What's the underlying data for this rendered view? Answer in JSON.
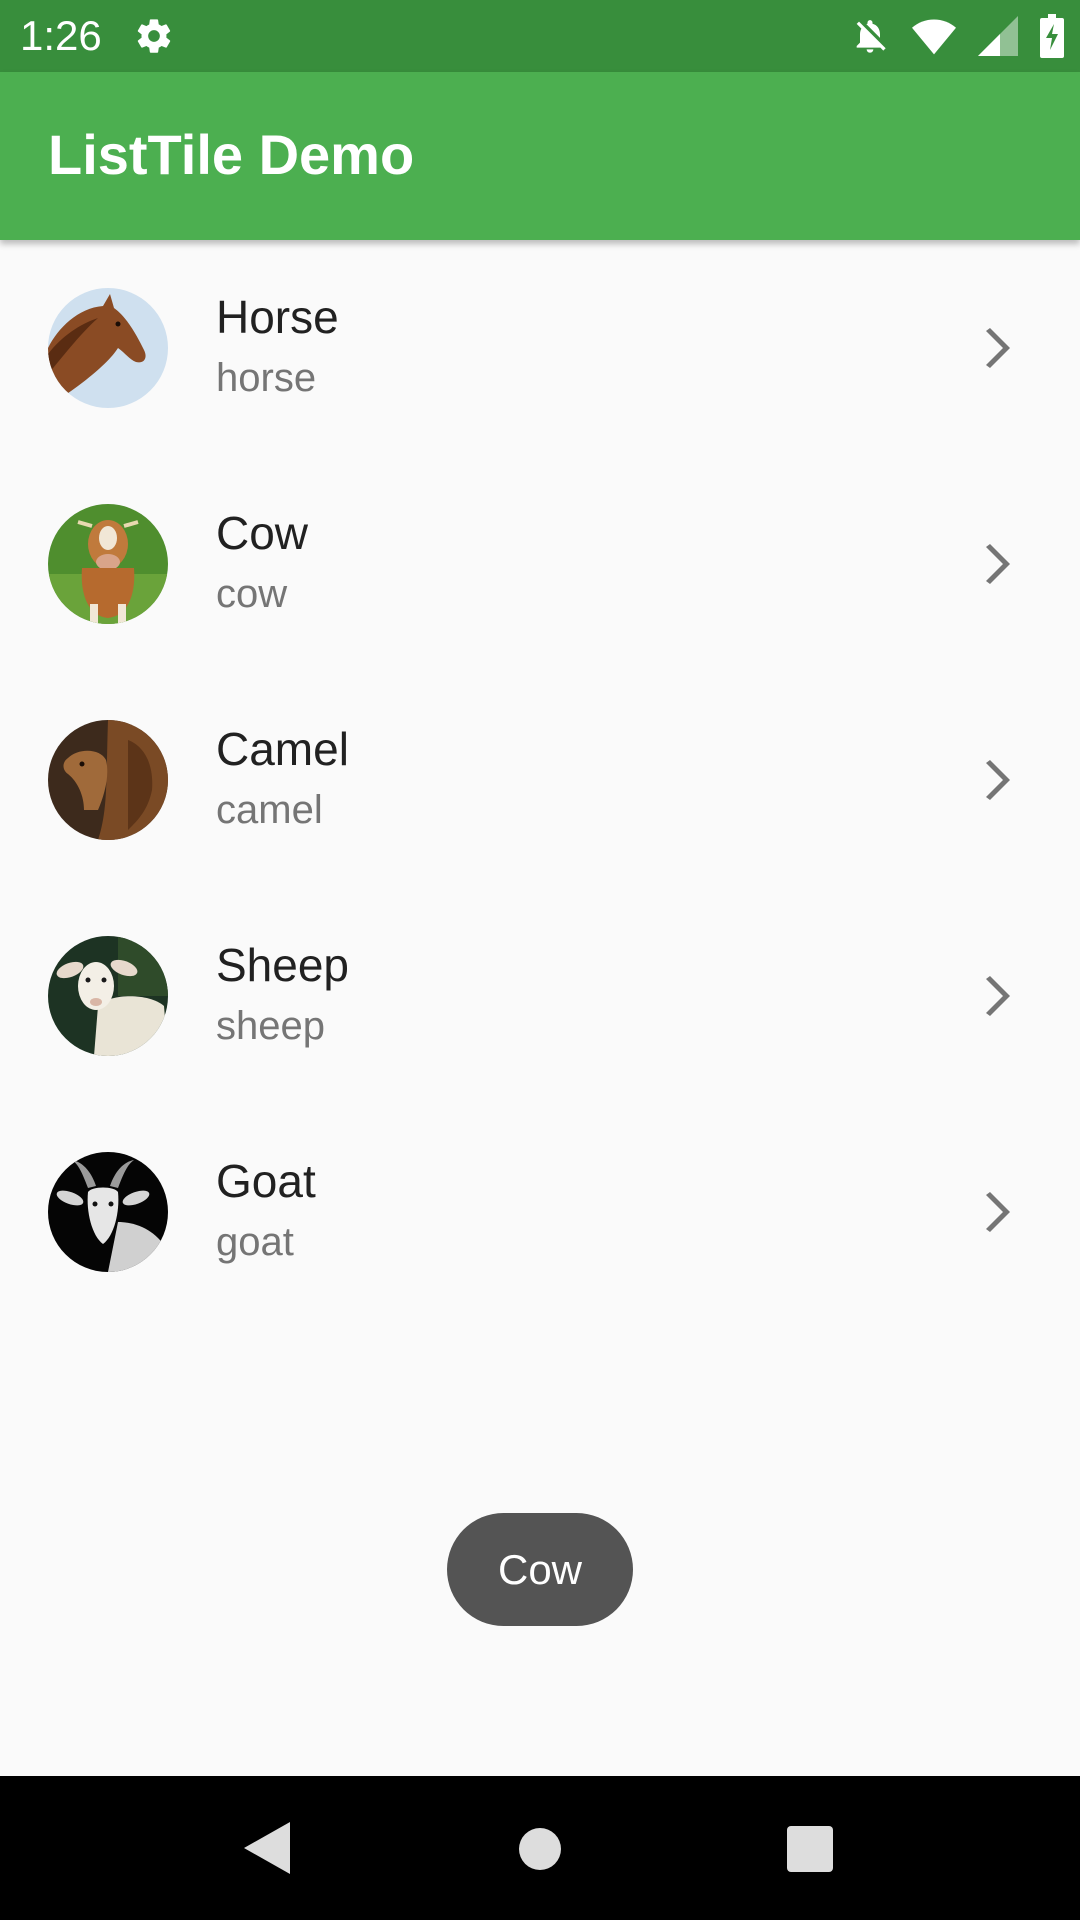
{
  "status_bar": {
    "time": "1:26",
    "icons": [
      "settings-icon",
      "notifications-off-icon",
      "wifi-icon",
      "cell-signal-icon",
      "battery-charging-icon"
    ],
    "color": "#388e3c"
  },
  "app_bar": {
    "title": "ListTile Demo",
    "color": "#4caf50"
  },
  "list": {
    "items": [
      {
        "title": "Horse",
        "subtitle": "horse",
        "avatar": "horse-avatar",
        "trailing_icon": "chevron-right-icon"
      },
      {
        "title": "Cow",
        "subtitle": "cow",
        "avatar": "cow-avatar",
        "trailing_icon": "chevron-right-icon"
      },
      {
        "title": "Camel",
        "subtitle": "camel",
        "avatar": "camel-avatar",
        "trailing_icon": "chevron-right-icon"
      },
      {
        "title": "Sheep",
        "subtitle": "sheep",
        "avatar": "sheep-avatar",
        "trailing_icon": "chevron-right-icon"
      },
      {
        "title": "Goat",
        "subtitle": "goat",
        "avatar": "goat-avatar",
        "trailing_icon": "chevron-right-icon"
      }
    ]
  },
  "toast": {
    "text": "Cow"
  },
  "nav_bar": {
    "buttons": [
      "back-icon",
      "home-icon",
      "recents-icon"
    ]
  }
}
